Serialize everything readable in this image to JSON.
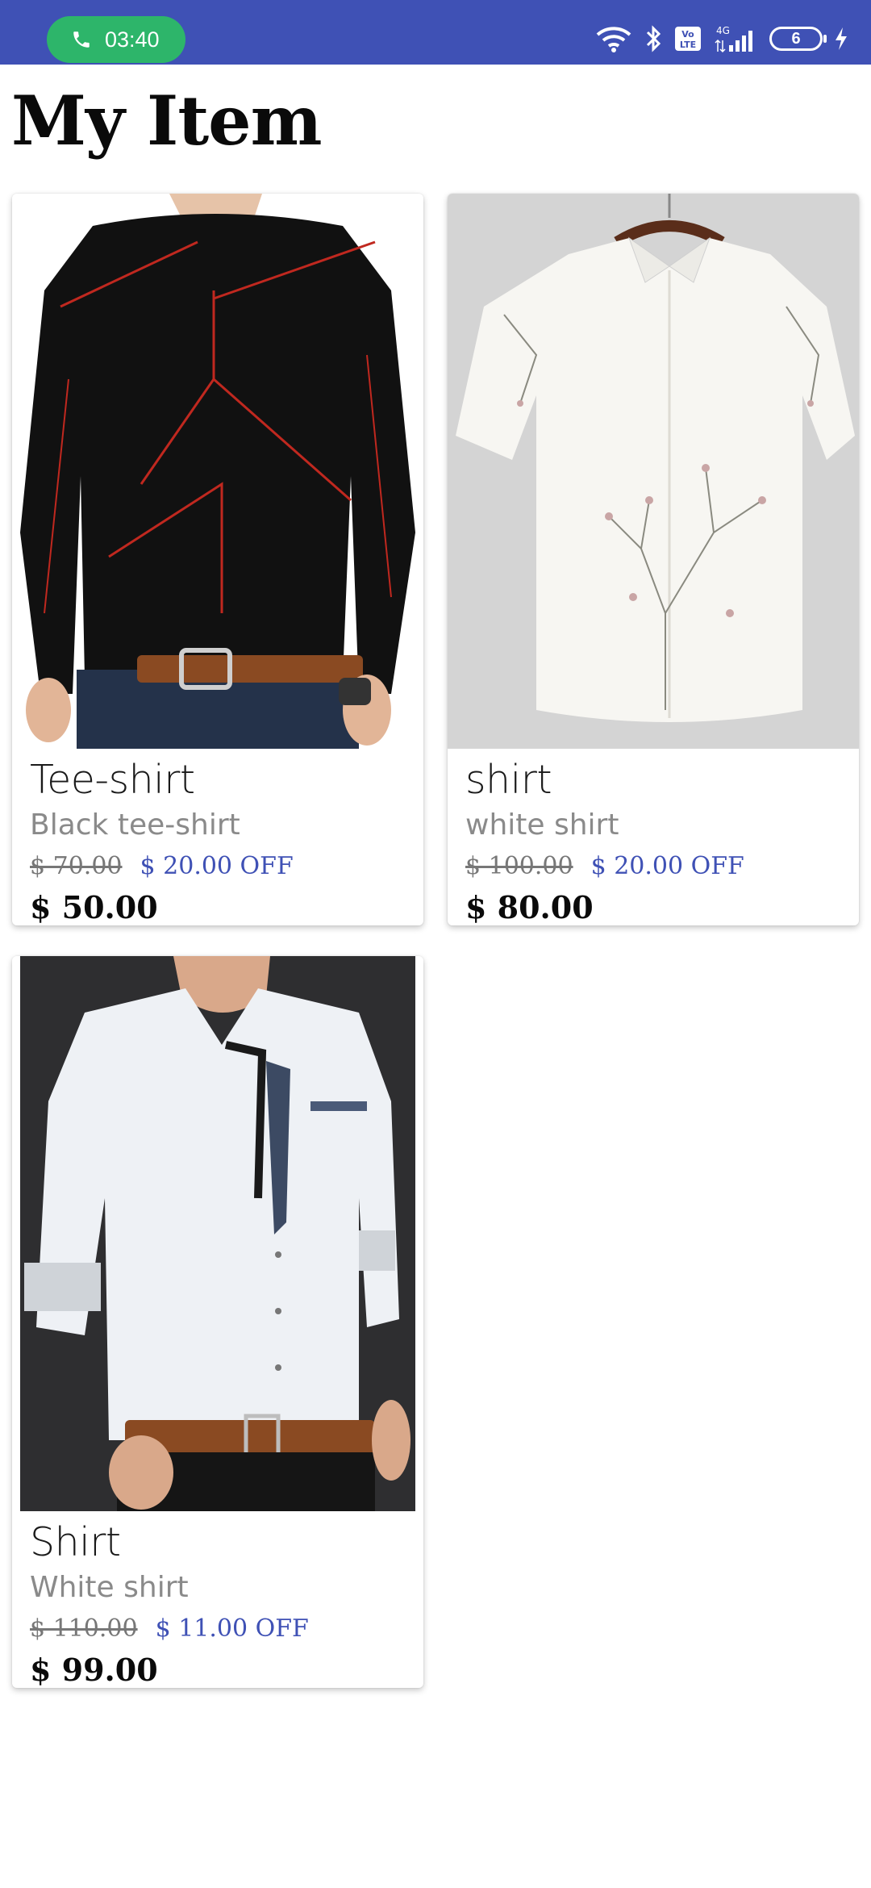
{
  "status_bar": {
    "time": "03:40",
    "battery_level": "6",
    "network_type": "4G",
    "volte_label": "Vo LTE",
    "icons": [
      "phone-icon",
      "wifi-icon",
      "bluetooth-icon",
      "volte-icon",
      "signal-icon",
      "battery-icon",
      "charging-icon"
    ],
    "background_color": "#3f51b5",
    "call_pill_color": "#2db56a"
  },
  "page": {
    "title": "My Item"
  },
  "items": [
    {
      "title": "Tee-shirt",
      "subtitle": "Black tee-shirt",
      "original_price": "$ 70.00",
      "discount": "$ 20.00 OFF",
      "final_price": "$ 50.00",
      "image": "black-tee-shirt-image"
    },
    {
      "title": "shirt",
      "subtitle": "white shirt",
      "original_price": "$ 100.00",
      "discount": "$ 20.00 OFF",
      "final_price": "$ 80.00",
      "image": "white-floral-shirt-image"
    },
    {
      "title": "Shirt",
      "subtitle": "White shirt",
      "original_price": "$ 110.00",
      "discount": "$ 11.00 OFF",
      "final_price": "$ 99.00",
      "image": "white-shirt-model-image"
    }
  ],
  "colors": {
    "accent": "#3f51b5",
    "discount_text": "#3f51b5"
  }
}
